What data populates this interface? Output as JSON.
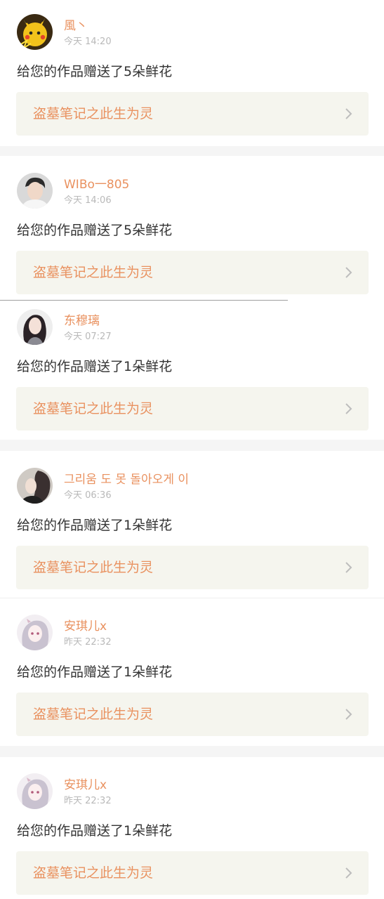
{
  "notifications": [
    {
      "username": "風丶",
      "time": "今天 14:20",
      "message": "给您的作品赠送了5朵鲜花",
      "work_title": "盗墓笔记之此生为灵",
      "avatar_icon": "pikachu-avatar-icon"
    },
    {
      "username": "WIBo一805",
      "time": "今天 14:06",
      "message": "给您的作品赠送了5朵鲜花",
      "work_title": "盗墓笔记之此生为灵",
      "avatar_icon": "young-man-avatar-icon"
    },
    {
      "username": "东穆璃",
      "time": "今天 07:27",
      "message": "给您的作品赠送了1朵鲜花",
      "work_title": "盗墓笔记之此生为灵",
      "avatar_icon": "girl-avatar-icon"
    },
    {
      "username": "그리움 도 못 돌아오게 이",
      "time": "今天 06:36",
      "message": "给您的作品赠送了1朵鲜花",
      "work_title": "盗墓笔记之此生为灵",
      "avatar_icon": "profile-avatar-icon"
    },
    {
      "username": "安琪儿x",
      "time": "昨天 22:32",
      "message": "给您的作品赠送了1朵鲜花",
      "work_title": "盗墓笔记之此生为灵",
      "avatar_icon": "anime-girl-avatar-icon"
    },
    {
      "username": "安琪儿x",
      "time": "昨天 22:32",
      "message": "给您的作品赠送了1朵鲜花",
      "work_title": "盗墓笔记之此生为灵",
      "avatar_icon": "anime-girl-avatar-icon"
    }
  ],
  "colors": {
    "accent": "#e9915f",
    "time_text": "#b9b9b9",
    "message_text": "#333333",
    "link_background": "#f5f5ee",
    "divider": "#f5f5f5"
  }
}
